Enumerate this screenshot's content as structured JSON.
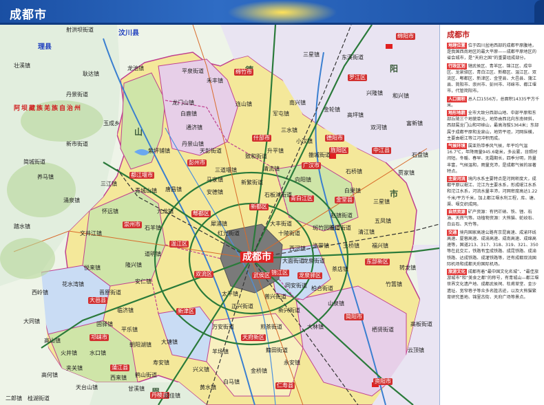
{
  "title": "成都市",
  "colors": {
    "title_bar": "#1a4fa3",
    "accent_red": "#d23030",
    "city_core": "#7a7a7a",
    "district_yellow": "#f4e89a",
    "district_green": "#cfe5a8",
    "district_purple": "#e7cfe8",
    "district_blue": "#c9dcf4",
    "outside": "#eef4e8",
    "river": "#3a7fd0",
    "expressway": "#2a7a3a",
    "railway": "#333333"
  },
  "map": {
    "region_labels": [
      "阿坝藏族羌族自治州",
      "德",
      "阳",
      "市",
      "眉",
      "山"
    ],
    "prefecture_labels": [
      "汶川县",
      "理县",
      "绵阳市",
      "德阳市",
      "资阳市"
    ],
    "district_labels": [
      "成都市",
      "锦江区",
      "武侯区",
      "双流区",
      "新都区",
      "郫都区",
      "温江区",
      "新津区",
      "龙泉驿区",
      "青白江区",
      "金堂县",
      "彭州市",
      "都江堰市",
      "崇州市",
      "大邑县",
      "邛崃市",
      "蒲江县",
      "简阳市",
      "中江县",
      "什邡市",
      "绵竹市",
      "广汉市",
      "罗江区",
      "旌阳区",
      "东部新区",
      "天府新区",
      "仁寿县",
      "丹棱县"
    ],
    "town_labels": [
      "耿达镇",
      "龙池镇",
      "紫坪铺镇",
      "青城山镇",
      "龙门山镇",
      "白鹿镇",
      "通济镇",
      "丹景山镇",
      "天彭街道",
      "唐昌镇",
      "安德镇",
      "犀浦镇",
      "红光街道",
      "三道堰镇",
      "九龙镇",
      "石羊镇",
      "文井江镇",
      "悦来镇",
      "道明镇",
      "隆兴镇",
      "三江镇",
      "怀远镇",
      "安仁镇",
      "晋原街道",
      "西岭镇",
      "大同镇",
      "花水湾镇",
      "高山镇",
      "临济镇",
      "平乐镇",
      "火井镇",
      "水口镇",
      "夹关镇",
      "固驿镇",
      "高何镇",
      "天台山镇",
      "鹤山街道",
      "大塘镇",
      "寿安镇",
      "朝阳湖镇",
      "西来镇",
      "甘溪镇",
      "成佳镇",
      "兴义镇",
      "羊场镇",
      "白马镇",
      "黄水镇",
      "金桥镇",
      "永安镇",
      "正兴街道",
      "籍田街道",
      "太平镇",
      "万安街道",
      "煎茶街道",
      "新兴街道",
      "大林镇",
      "普兴街道",
      "龙泉街道",
      "洛带镇",
      "西河镇",
      "同安街道",
      "柏合街道",
      "山泉镇",
      "茶店镇",
      "十陵街道",
      "大面街道",
      "赵镇街道",
      "清江镇",
      "竹篙镇",
      "土桥镇",
      "福兴镇",
      "三星镇",
      "淮口街道",
      "白果镇",
      "五凤镇",
      "转龙镇",
      "栖贤街道",
      "高板街道",
      "云顶镇",
      "新繁街道",
      "马家镇",
      "清流镇",
      "大丰街道",
      "石板滩街道",
      "斑竹园街道",
      "军屯镇",
      "升平镇",
      "致和街道",
      "小汉镇",
      "连山镇",
      "南兴镇",
      "三水镇",
      "向阳镇",
      "雒城街道",
      "金轮镇",
      "高坪镇",
      "兴隆镇",
      "和兴镇",
      "双河镇",
      "富新镇",
      "贾家镇",
      "石盘镇",
      "石桥镇",
      "三星镇",
      "东溪街道",
      "禾丰镇",
      "平泉街道",
      "丹景街道",
      "壮溪镇",
      "射洪坝街道",
      "简城街道",
      "新市街道",
      "养马镇",
      "涌泉镇",
      "踏水镇",
      "玉成乡",
      "二郎镇",
      "桂湖街道",
      "天回镇",
      "南充路",
      "华兴镇",
      "汉旺镇",
      "九龙镇",
      "孝泉镇",
      "八角井街道",
      "双东镇",
      "黄许镇",
      "德新镇",
      "和新镇",
      "扬嘉镇",
      "辑庆镇",
      "永太镇",
      "富驿镇",
      "万佛镇",
      "双凤镇",
      "兴隆镇",
      "仓山镇",
      "南华镇",
      "集凤镇",
      "东北镇",
      "继光镇",
      "永兴镇",
      "冯店镇",
      "黄鹿镇",
      "广济镇",
      "新市镇",
      "金鱼镇",
      "桂花镇",
      "通济镇",
      "磨盘镇",
      "湔底镇",
      "碉关镇",
      "三溪镇",
      "天池镇",
      "金华镇",
      "土门镇",
      "石亭江",
      "邓家镇",
      "漩口镇",
      "水磨镇",
      "映秀镇",
      "三江镇",
      "卧龙镇",
      "耿达镇",
      "草坡乡",
      "银杏乡",
      "绵虒镇",
      "威州镇",
      "雁门乡",
      "龙溪乡",
      "杂谷脑镇",
      "薛城镇",
      "桃坪镇",
      "通化乡",
      "甘堡乡",
      "朴头乡",
      "米亚罗镇",
      "古尔沟镇",
      "下孟乡",
      "上孟乡"
    ]
  },
  "sidebar": {
    "title": "成都市",
    "sections": [
      {
        "tag": "地理位置",
        "text": "位于四川盆地西部的成都平原腹地，是我国西南地区的最大平原——成都平原地区的省会城市，是“天府之国”的重要组成部分。"
      },
      {
        "tag": "行政区划",
        "text": "辖武侯区、青羊区、锦江区、成华区、龙泉驿区、青白江区、新都区、温江区、双流区、郫都区、新津区、金堂县、大邑县、蒲江县、简阳市、崇州市、彭州市、邛崃市、都江堰市，代管简阳市。"
      },
      {
        "tag": "人口面积",
        "text": "总人口1556万，总面积14335平方千米。"
      },
      {
        "tag": "地形地貌",
        "text": "全市大致分西部山地、中部平原和东部丘陵三个地貌单元，地势由西北向东南倾斜，西部属龙门山和邛崃山，最高海拔5364米；东部属于成都平原和龙泉山，地势平坦，河网纵横，主要由岷江等江河冲积而成。"
      },
      {
        "tag": "气候环境",
        "text": "属亚热带季风气候，年平均气温16.7℃，年降雨量945.6毫米，多云雾，日照时间短。冬暖、春早、无霜期长，四季分明，热量丰富，气候温和，雨量充沛，是成都气候的显著特点。"
      },
      {
        "tag": "主要河流",
        "text": "境内水系主要特点是河网密度大，成都平原以岷江、沱江为主要水系，形成岷江水系和沱江水系，河流水量丰沛，河网密度高达1.22千米/平方千米，加上都江堰水利工程，库、塘、渠、堰交织成网。"
      },
      {
        "tag": "自然资源",
        "text": "矿产资源：有钙芒硝、铁、锂、石油、天然气等。动植物资源：大熊猫、蛇纹石、白云石、天竹等。"
      },
      {
        "tag": "交通",
        "text": "境内国家高速公路有京昆高速、成渝环线高速、厦蓉高速、成渝高速、成南高速、成绵高速等，国道213、317、318、319、321、350等在此交汇，铁路有宝成铁路、成昆铁路、成渝铁路、达成铁路、成灌铁路等，还有成都双流国际机场和成都天府国际机场。"
      },
      {
        "tag": "旅游文化",
        "text": "成都有着“最中国文化名城”、“最佳旅游城市”和“美食之都”的称号，有青城山—都江堰世界文化遗产地、成都武侯祠、杜甫草堂、金沙遗址、宽窄巷子等众多名胜古迹，以及大熊猫繁育研究基地、锦里古街、天府广场等景点。"
      }
    ]
  }
}
